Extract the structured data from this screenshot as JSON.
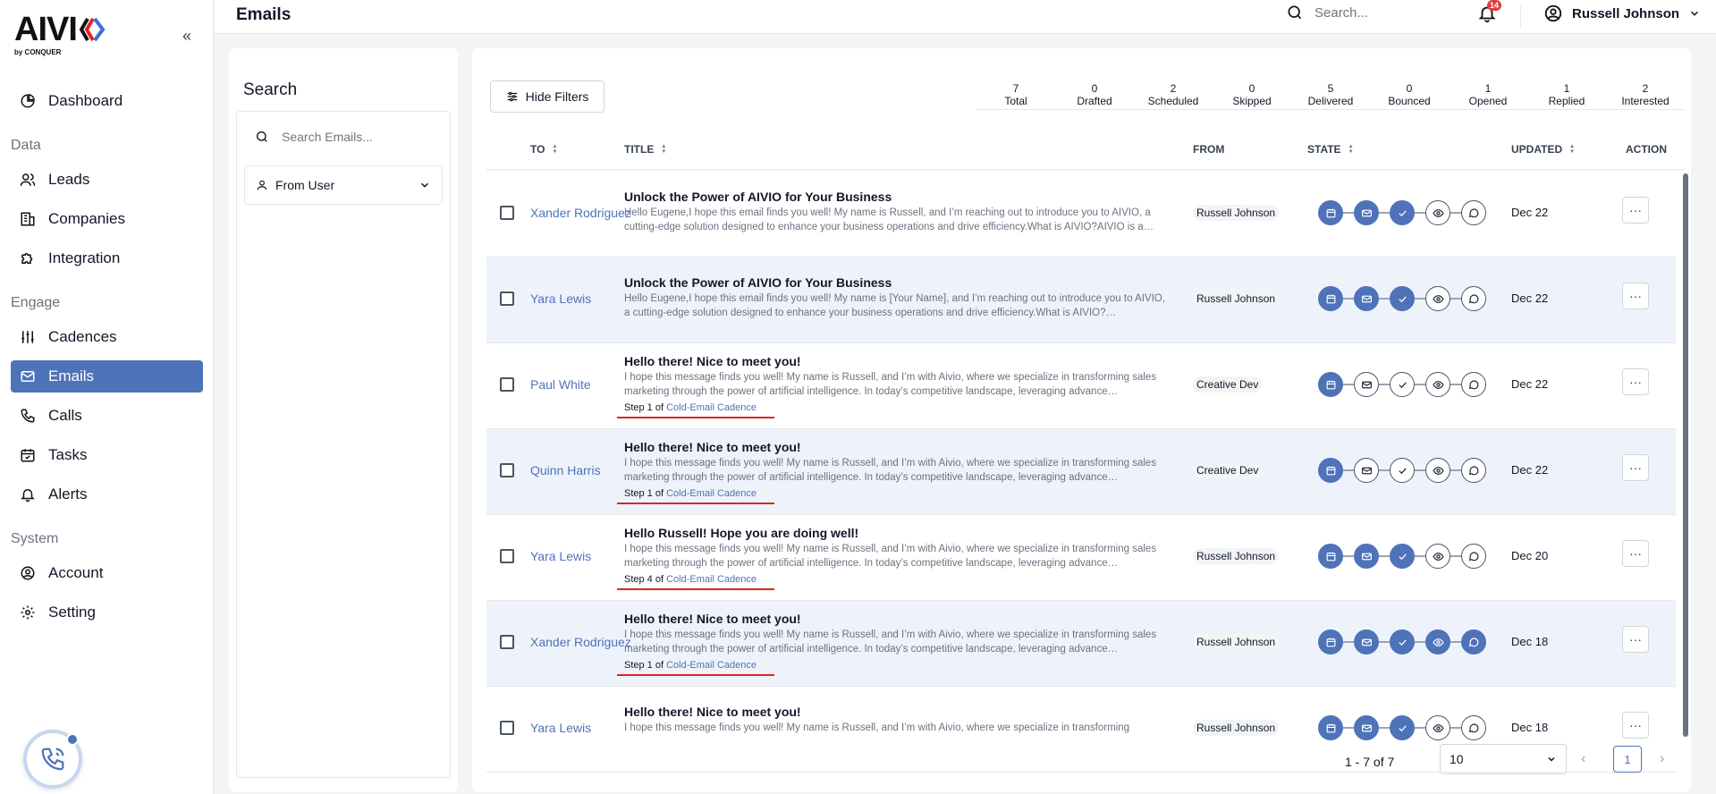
{
  "brand": {
    "name": "AIVIO",
    "tagline": "by CONQUER"
  },
  "colors": {
    "accent": "#4f73b8",
    "alert": "#e02424"
  },
  "sidebar": {
    "items": [
      {
        "label": "Dashboard",
        "icon": "pie-chart-icon"
      },
      {
        "label": "Leads",
        "icon": "users-icon"
      },
      {
        "label": "Companies",
        "icon": "building-icon"
      },
      {
        "label": "Integration",
        "icon": "puzzle-icon"
      },
      {
        "label": "Cadences",
        "icon": "sliders-icon"
      },
      {
        "label": "Emails",
        "icon": "mail-icon",
        "active": true
      },
      {
        "label": "Calls",
        "icon": "phone-icon"
      },
      {
        "label": "Tasks",
        "icon": "calendar-check-icon"
      },
      {
        "label": "Alerts",
        "icon": "bell-icon"
      },
      {
        "label": "Account",
        "icon": "user-circle-icon"
      },
      {
        "label": "Setting",
        "icon": "gear-icon"
      }
    ],
    "groups": {
      "data": "Data",
      "engage": "Engage",
      "system": "System"
    }
  },
  "header": {
    "title": "Emails",
    "search_placeholder": "Search...",
    "notifications": "14",
    "user_name": "Russell Johnson"
  },
  "filters": {
    "title": "Search",
    "search_placeholder": "Search Emails...",
    "from_user": "From User"
  },
  "toolbar": {
    "hide_filters": "Hide Filters"
  },
  "stats": [
    {
      "value": "7",
      "label": "Total"
    },
    {
      "value": "0",
      "label": "Drafted"
    },
    {
      "value": "2",
      "label": "Scheduled"
    },
    {
      "value": "0",
      "label": "Skipped"
    },
    {
      "value": "5",
      "label": "Delivered"
    },
    {
      "value": "0",
      "label": "Bounced"
    },
    {
      "value": "1",
      "label": "Opened"
    },
    {
      "value": "1",
      "label": "Replied"
    },
    {
      "value": "2",
      "label": "Interested"
    }
  ],
  "table": {
    "columns": {
      "to": "TO",
      "title": "TITLE",
      "from": "FROM",
      "state": "STATE",
      "updated": "UPDATED",
      "action": "ACTION"
    },
    "rows": [
      {
        "to": "Xander Rodriguez",
        "subject": "Unlock the Power of AIVIO for Your Business",
        "preview": "Hello Eugene,I hope this email finds you well! My name is Russell, and I’m reaching out to introduce you to AIVIO, a cutting-edge solution designed to enhance your business operations and drive efficiency.What is AIVIO?AIVIO is a…",
        "step": "",
        "cadence": "",
        "from": "Russell Johnson",
        "updated": "Dec 22",
        "states": [
          true,
          true,
          true,
          false,
          false
        ]
      },
      {
        "to": "Yara Lewis",
        "subject": "Unlock the Power of AIVIO for Your Business",
        "preview": "Hello Eugene,I hope this email finds you well! My name is [Your Name], and I’m reaching out to introduce you to AIVIO, a cutting-edge solution designed to enhance your business operations and drive efficiency.What is AIVIO?…",
        "step": "",
        "cadence": "",
        "from": "Russell Johnson",
        "updated": "Dec 22",
        "states": [
          true,
          true,
          true,
          false,
          false
        ]
      },
      {
        "to": "Paul White",
        "subject": "Hello there! Nice to meet you!",
        "preview": "I hope this message finds you well! My name is Russell, and I’m with Aivio, where we specialize in transforming sales marketing through the power of artificial intelligence. In today’s competitive landscape, leveraging advance…",
        "step": "Step 1 of",
        "cadence": "Cold-Email Cadence",
        "from": "Creative Dev",
        "updated": "Dec 22",
        "states": [
          true,
          false,
          false,
          false,
          false
        ]
      },
      {
        "to": "Quinn Harris",
        "subject": "Hello there! Nice to meet you!",
        "preview": "I hope this message finds you well! My name is Russell, and I’m with Aivio, where we specialize in transforming sales marketing through the power of artificial intelligence. In today’s competitive landscape, leveraging advance…",
        "step": "Step 1 of",
        "cadence": "Cold-Email Cadence",
        "from": "Creative Dev",
        "updated": "Dec 22",
        "states": [
          true,
          false,
          false,
          false,
          false
        ]
      },
      {
        "to": "Yara Lewis",
        "subject": "Hello Russell! Hope you are doing well!",
        "preview": "I hope this message finds you well! My name is Russell, and I’m with Aivio, where we specialize in transforming sales marketing through the power of artificial intelligence. In today’s competitive landscape, leveraging advance…",
        "step": "Step 4 of",
        "cadence": "Cold-Email Cadence",
        "from": "Russell Johnson",
        "updated": "Dec 20",
        "states": [
          true,
          true,
          true,
          false,
          false
        ]
      },
      {
        "to": "Xander Rodriguez",
        "subject": "Hello there! Nice to meet you!",
        "preview": "I hope this message finds you well! My name is Russell, and I’m with Aivio, where we specialize in transforming sales marketing through the power of artificial intelligence. In today’s competitive landscape, leveraging advance…",
        "step": "Step 1 of",
        "cadence": "Cold-Email Cadence",
        "from": "Russell Johnson",
        "updated": "Dec 18",
        "states": [
          true,
          true,
          true,
          true,
          true
        ]
      },
      {
        "to": "Yara Lewis",
        "subject": "Hello there! Nice to meet you!",
        "preview": "I hope this message finds you well! My name is Russell, and I’m with Aivio, where we specialize in transforming",
        "step": "",
        "cadence": "",
        "from": "Russell Johnson",
        "updated": "Dec 18",
        "states": [
          true,
          true,
          true,
          false,
          false
        ]
      }
    ]
  },
  "pagination": {
    "range": "1 - 7 of 7",
    "page_size": "10",
    "page": "1"
  }
}
